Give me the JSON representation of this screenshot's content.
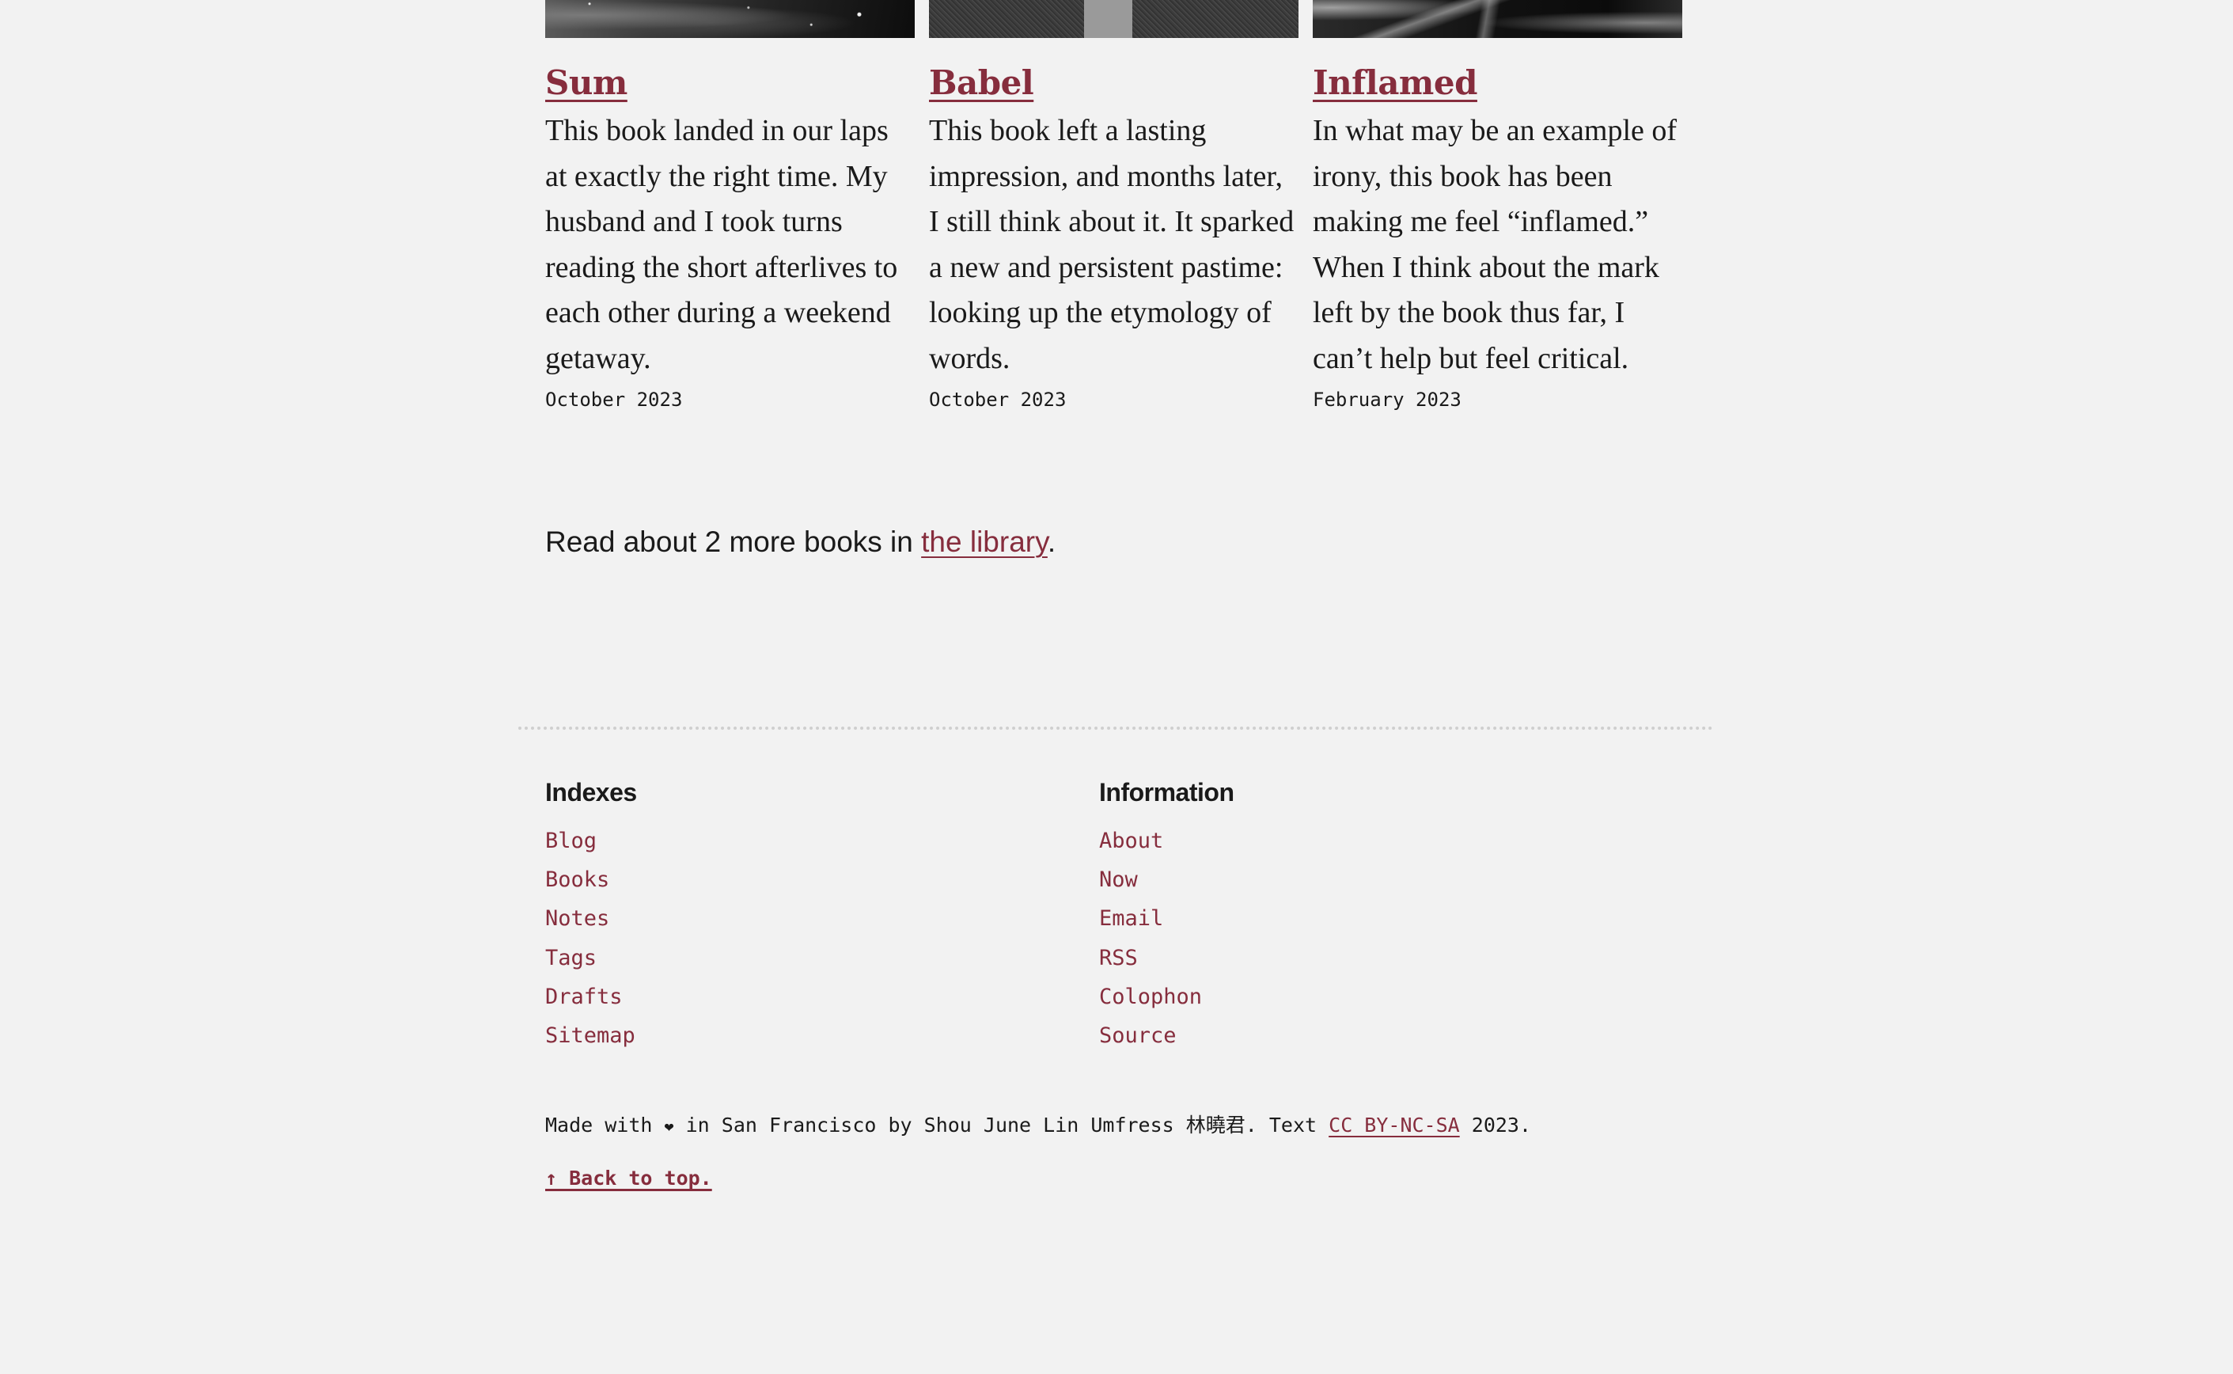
{
  "colors": {
    "background": "#f2f2f2",
    "accent": "#862d3d",
    "text": "#1a1a1a",
    "divider": "#cfcfcf"
  },
  "books": [
    {
      "title": "Sum",
      "thumbnail": "sum-cover-image",
      "description": "This book landed in our laps at exactly the right time. My husband and I took turns reading the short afterlives to each other during a weekend getaway.",
      "date": "October 2023"
    },
    {
      "title": "Babel",
      "thumbnail": "babel-cover-image",
      "description": "This book left a lasting impression, and months later, I still think about it. It sparked a new and persistent pastime: looking up the etymology of words.",
      "date": "October 2023"
    },
    {
      "title": "Inflamed",
      "thumbnail": "inflamed-cover-image",
      "description": "In what may be an example of irony, this book has been making me feel “inflamed.” When I think about the mark left by the book thus far, I can’t help but feel critical.",
      "date": "February 2023"
    }
  ],
  "more_books": {
    "prefix": "Read about 2 more books in ",
    "link_label": "the library",
    "suffix": "."
  },
  "footer": {
    "indexes": {
      "heading": "Indexes",
      "links": [
        "Blog",
        "Books",
        "Notes",
        "Tags",
        "Drafts",
        "Sitemap"
      ]
    },
    "information": {
      "heading": "Information",
      "links": [
        "About",
        "Now",
        "Email",
        "RSS",
        "Colophon",
        "Source"
      ]
    },
    "credits": {
      "made_with": "Made with ",
      "heart_icon": "❤",
      "location_author": " in San Francisco by Shou June Lin Umfress 林曉君. Text ",
      "license_label": "CC BY-NC-SA",
      "year": " 2023."
    },
    "back_to_top": "↑ Back to top."
  }
}
